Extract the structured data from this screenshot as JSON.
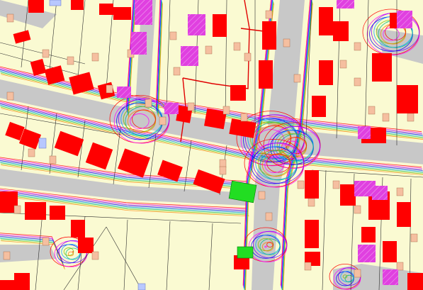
{
  "map": {
    "colors": {
      "ground": "#fafad2",
      "road": "#c8c8c8",
      "plot_line": "#2b2b2b",
      "building_major": "#ff0000",
      "building_minor": "#f5bfa0",
      "building_special": "#e040e0",
      "building_green": "#22dd22",
      "building_blue": "#b8c8ff",
      "boundary": "#e00000"
    },
    "line_palette": [
      "#ff0000",
      "#ff00ff",
      "#8000ff",
      "#0000ff",
      "#00a0ff",
      "#00c080",
      "#80c000",
      "#ff8000"
    ],
    "legend_items": []
  }
}
